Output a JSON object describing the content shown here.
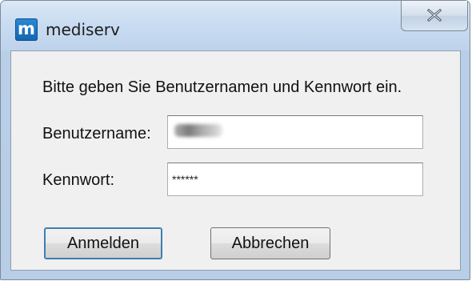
{
  "window": {
    "title": "mediserv",
    "app_icon_letter": "m",
    "accent_color": "#1a73c2"
  },
  "dialog": {
    "prompt": "Bitte geben Sie Benutzernamen und Kennwort ein.",
    "username_label": "Benutzername:",
    "username_value": "",
    "password_label": "Kennwort:",
    "password_value": "******",
    "login_label": "Anmelden",
    "cancel_label": "Abbrechen"
  },
  "icons": {
    "close": "close-icon",
    "app": "mediserv-app-icon"
  }
}
